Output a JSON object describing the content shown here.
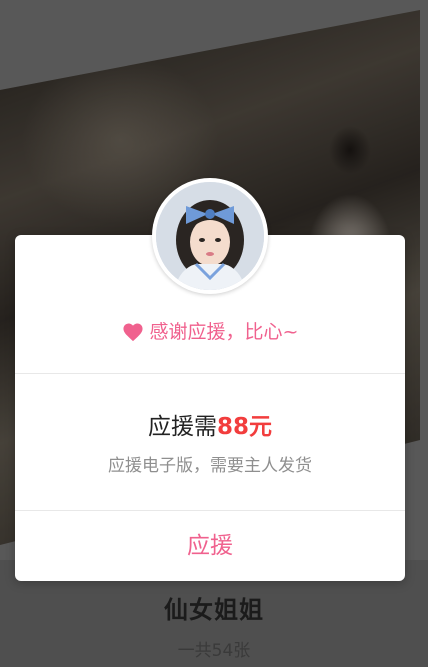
{
  "album": {
    "title": "仙女姐姐",
    "count": "一共54张"
  },
  "modal": {
    "thanks_text": "感谢应援，比心~",
    "price_prefix": "应援需",
    "price_amount": "88元",
    "description": "应援电子版，需要主人发货",
    "support_button": "应援"
  },
  "icons": {
    "heart": "heart-icon"
  },
  "colors": {
    "accent_pink": "#f0618e",
    "price_red": "#f23d3d",
    "desc_gray": "#8f8f8f"
  }
}
